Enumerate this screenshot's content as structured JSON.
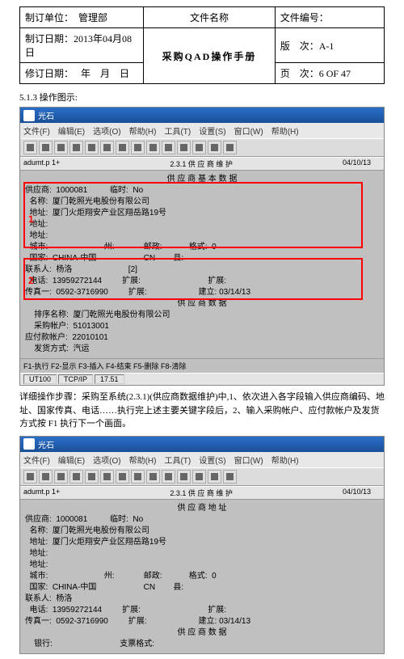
{
  "header": {
    "dept_label": "制订单位：",
    "dept": "管理部",
    "filename_label": "文件名称",
    "fileno_label": "文件编号：",
    "created_label": "制订日期：",
    "created": "2013年04月08日",
    "title": "采购QAD操作手册",
    "ver_label": "版　次：",
    "ver": "A-1",
    "rev_label": "修订日期：",
    "rev": "年　月　日",
    "page_label": "页　次：",
    "page": "6  OF  47"
  },
  "section": "5.1.3 操作图示:",
  "ss1": {
    "titlebar": "光石",
    "menu": [
      "文件(F)",
      "编辑(E)",
      "选项(O)",
      "帮助(H)",
      "工具(T)",
      "设置(S)",
      "窗口(W)",
      "帮助(H)"
    ],
    "stat_left": "adumt.p 1+",
    "stat_ctr": "2.3.1 供 应 商 维 护",
    "stat_rt": "04/10/13",
    "t": {
      "h1": "供 应 商 基 本 数 据",
      "l1": "供应商:  1000081          临时:  No",
      "l2": "  名称:  厦门乾照光电股份有限公司",
      "l3": "  地址:  厦门火炬翔安产业区翔岳路19号",
      "l4": "  地址:",
      "l5": "  地址:",
      "l6": "  城市:                         州:             邮政:            格式:  0",
      "l7": "  国家:  CHINA-中国                     CN        县:",
      "l8": "联系人:  杨洛                         [2]",
      "l9": "  电话:  13959272144         扩展:                              扩展:",
      "l10": "传真一:  0592-3716990         扩展:                       建立: 03/14/13",
      "h2": "供 应 商 数 据",
      "l11": "    排序名称:  厦门乾照光电股份有限公司",
      "l12": "    采购帐户:  51013001",
      "l13": "应付款帐户:  22010101",
      "l14": "    发货方式:  汽运",
      "num1": "1",
      "num2": "2"
    },
    "fkeys": "F1-执行  F2-显示  F3-插入  F4-结束  F5-删除  F8-清除",
    "status": [
      "UT100",
      "TCP/IP",
      "17.51"
    ]
  },
  "body_text": "详细操作步骤：采购至系统(2.3.1)(供应商数据维护)中,1、依次进入各字段输入供应商编码、地址、国家传真、电话……执行完上述主要关键字段后，2、输入采购帐户、应付款帐户及发货方式按 F1 执行下一个画面。",
  "ss2": {
    "stat_ctr2": "供 应 商 地 址",
    "t": {
      "l1": "供应商:  1000081          临时:  No",
      "l2": "  名称:  厦门乾照光电股份有限公司",
      "l3": "  地址:  厦门火炬翔安产业区翔岳路19号",
      "l4": "  地址:",
      "l5": "  地址:",
      "l6": "  城市:                         州:             邮政:            格式:  0",
      "l7": "  国家:  CHINA-中国                     CN        县:",
      "l8": "联系人:  杨洛",
      "l9": "  电话:  13959272144         扩展:                              扩展:",
      "l10": "传真一:  0592-3716990         扩展:                       建立: 03/14/13",
      "h2": "供 应 商 数 据",
      "l11": "    银行:                              支票格式:"
    }
  }
}
